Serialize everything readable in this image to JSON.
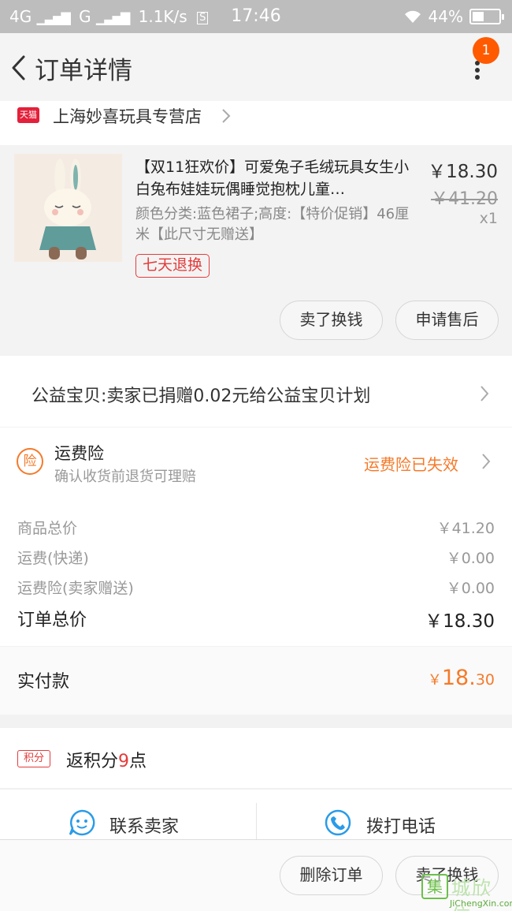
{
  "status_bar": {
    "network": "4G",
    "carrier2": "G",
    "speed": "1.1K/s",
    "s_badge": "S",
    "time": "17:46",
    "battery": "44%",
    "battery_level": 0.44
  },
  "header": {
    "title": "订单详情",
    "notification_count": "1",
    "back_icon": "chevron-left-icon",
    "more_icon": "more-vertical-icon"
  },
  "shop": {
    "badge": "天猫",
    "name": "上海妙喜玩具专营店"
  },
  "product": {
    "title": "【双11狂欢价】可爱兔子毛绒玩具女生小白兔布娃娃玩偶睡觉抱枕儿童…",
    "variant": "颜色分类:蓝色裙子;高度:【特价促销】46厘米【此尺寸无赠送】",
    "tag": "七天退换",
    "price": "￥18.30",
    "original_price": "￥41.20",
    "quantity": "x1",
    "buttons": [
      "卖了换钱",
      "申请售后"
    ]
  },
  "charity": {
    "text": "公益宝贝:卖家已捐赠0.02元给公益宝贝计划"
  },
  "insurance": {
    "icon_text": "险",
    "title": "运费险",
    "subtitle": "确认收货前退货可理赔",
    "status": "运费险已失效"
  },
  "summary": {
    "rows": [
      {
        "label": "商品总价",
        "value": "￥41.20"
      },
      {
        "label": "运费(快递)",
        "value": "￥0.00"
      },
      {
        "label": "运费险(卖家赠送)",
        "value": "￥0.00"
      }
    ],
    "total_label": "订单总价",
    "total_value": "￥18.30",
    "paid_label": "实付款",
    "paid_symbol": "￥",
    "paid_int": "18.",
    "paid_dec": "30"
  },
  "points": {
    "badge": "积分",
    "prefix": "返积分",
    "number": "9",
    "suffix": "点"
  },
  "contact": {
    "seller": "联系卖家",
    "phone": "拨打电话"
  },
  "bottom_bar": {
    "buttons": [
      "删除订单",
      "卖了换钱"
    ]
  },
  "watermark": {
    "mark": "集",
    "cn": "城欣信",
    "en": "JiChengXin.com"
  },
  "colors": {
    "accent": "#f57a2a",
    "badge": "#ff5a00",
    "tmall": "#e4203a",
    "tag_red": "#e43b3b",
    "contact_blue": "#2a9be8"
  }
}
